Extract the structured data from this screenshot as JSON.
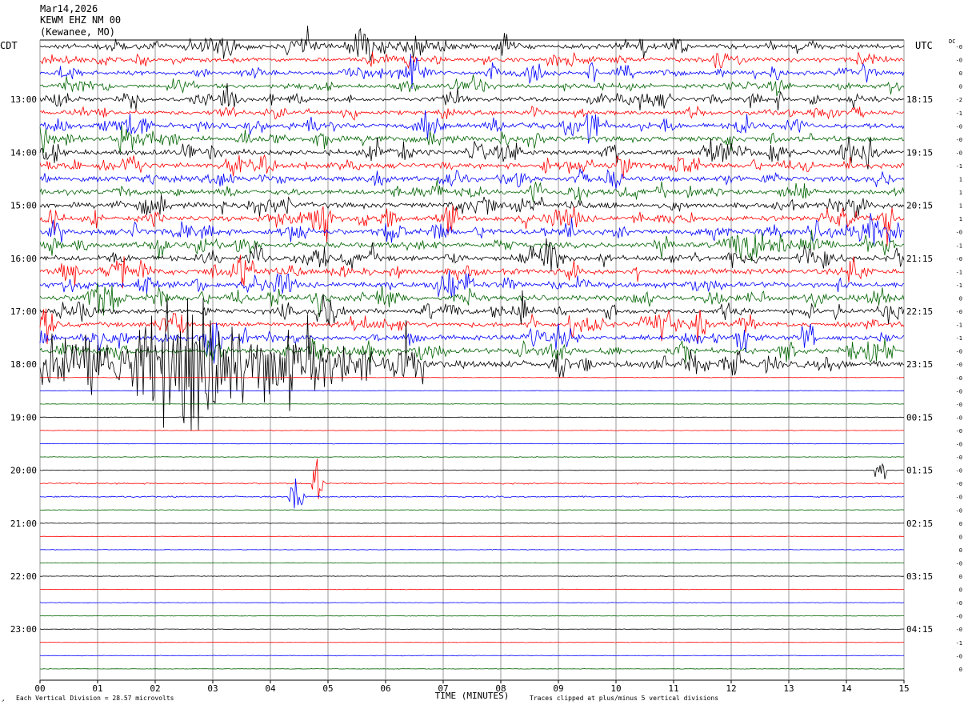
{
  "header": {
    "date": "Mar14,2026",
    "station": "KEWM EHZ NM 00",
    "location": "(Kewanee, MO)"
  },
  "tz_left": "CDT",
  "tz_right": "UTC",
  "dc_label": "DC",
  "chart_data": {
    "type": "seismogram",
    "xlabel": "TIME (MINUTES)",
    "x_ticks": [
      "00",
      "01",
      "02",
      "03",
      "04",
      "05",
      "06",
      "07",
      "08",
      "09",
      "10",
      "11",
      "12",
      "13",
      "14",
      "15"
    ],
    "xlim": [
      0,
      15
    ],
    "rows_per_hour": 4,
    "n_traces": 48,
    "trace_colors": [
      "#000000",
      "#ff0000",
      "#0000ff",
      "#006400"
    ],
    "left_hour_labels": [
      {
        "row": 4,
        "text": "13:00"
      },
      {
        "row": 8,
        "text": "14:00"
      },
      {
        "row": 12,
        "text": "15:00"
      },
      {
        "row": 16,
        "text": "16:00"
      },
      {
        "row": 20,
        "text": "17:00"
      },
      {
        "row": 24,
        "text": "18:00"
      },
      {
        "row": 28,
        "text": "19:00"
      },
      {
        "row": 32,
        "text": "20:00"
      },
      {
        "row": 36,
        "text": "21:00"
      },
      {
        "row": 40,
        "text": "22:00"
      },
      {
        "row": 44,
        "text": "23:00"
      }
    ],
    "right_hour_labels": [
      {
        "row": 4,
        "text": "18:15"
      },
      {
        "row": 8,
        "text": "19:15"
      },
      {
        "row": 12,
        "text": "20:15"
      },
      {
        "row": 16,
        "text": "21:15"
      },
      {
        "row": 20,
        "text": "22:15"
      },
      {
        "row": 24,
        "text": "23:15"
      },
      {
        "row": 28,
        "text": "00:15"
      },
      {
        "row": 32,
        "text": "01:15"
      },
      {
        "row": 36,
        "text": "02:15"
      },
      {
        "row": 40,
        "text": "03:15"
      },
      {
        "row": 44,
        "text": "04:15"
      }
    ],
    "dc_offsets": [
      "-0",
      "-0",
      "0",
      "0",
      "-2",
      "-1",
      "-0",
      "-0",
      "-0",
      "-1",
      "1",
      "1",
      "1",
      "1",
      "-0",
      "-1",
      "-0",
      "-1",
      "-1",
      "0",
      "-0",
      "-1",
      "-1",
      "-0",
      "-0",
      "-0",
      "-0",
      "-0",
      "-0",
      "-0",
      "-0",
      "-0",
      "-0",
      "-0",
      "-0",
      "-0",
      "0",
      "0",
      "0",
      "-0",
      "0",
      "0",
      "-0",
      "-0",
      "-0",
      "-1",
      "-0",
      "0"
    ],
    "amplitude_levels": [
      2.2,
      1.8,
      1.8,
      1.8,
      1.8,
      1.8,
      2.2,
      2.4,
      2.4,
      2.2,
      2.2,
      2.2,
      2.4,
      2.4,
      2.4,
      2.4,
      2.4,
      2.4,
      2.4,
      2.4,
      2.2,
      2.2,
      2.2,
      2.4,
      3.0,
      0.25,
      0.25,
      0.25,
      0.25,
      0.25,
      0.25,
      0.3,
      0.3,
      0.6,
      0.6,
      0.3,
      0.25,
      0.25,
      0.25,
      0.25,
      0.25,
      0.25,
      0.25,
      0.25,
      0.25,
      0.25,
      0.3,
      0.25
    ],
    "events": [
      {
        "row": 24,
        "minute_start": 0.0,
        "minute_end": 5.4,
        "peak_divisions": 5
      },
      {
        "row": 24,
        "minute_start": 6.0,
        "minute_end": 6.7,
        "peak_divisions": 3
      },
      {
        "row": 32,
        "minute_start": 14.5,
        "minute_end": 14.7,
        "peak_divisions": 1.5
      },
      {
        "row": 33,
        "minute_start": 4.7,
        "minute_end": 4.95,
        "peak_divisions": 3
      },
      {
        "row": 34,
        "minute_start": 4.3,
        "minute_end": 4.6,
        "peak_divisions": 2
      }
    ],
    "footer_left": "Each Vertical Division =   28.57 microvolts",
    "footer_right": "Traces clipped at plus/minus 5 vertical divisions"
  }
}
